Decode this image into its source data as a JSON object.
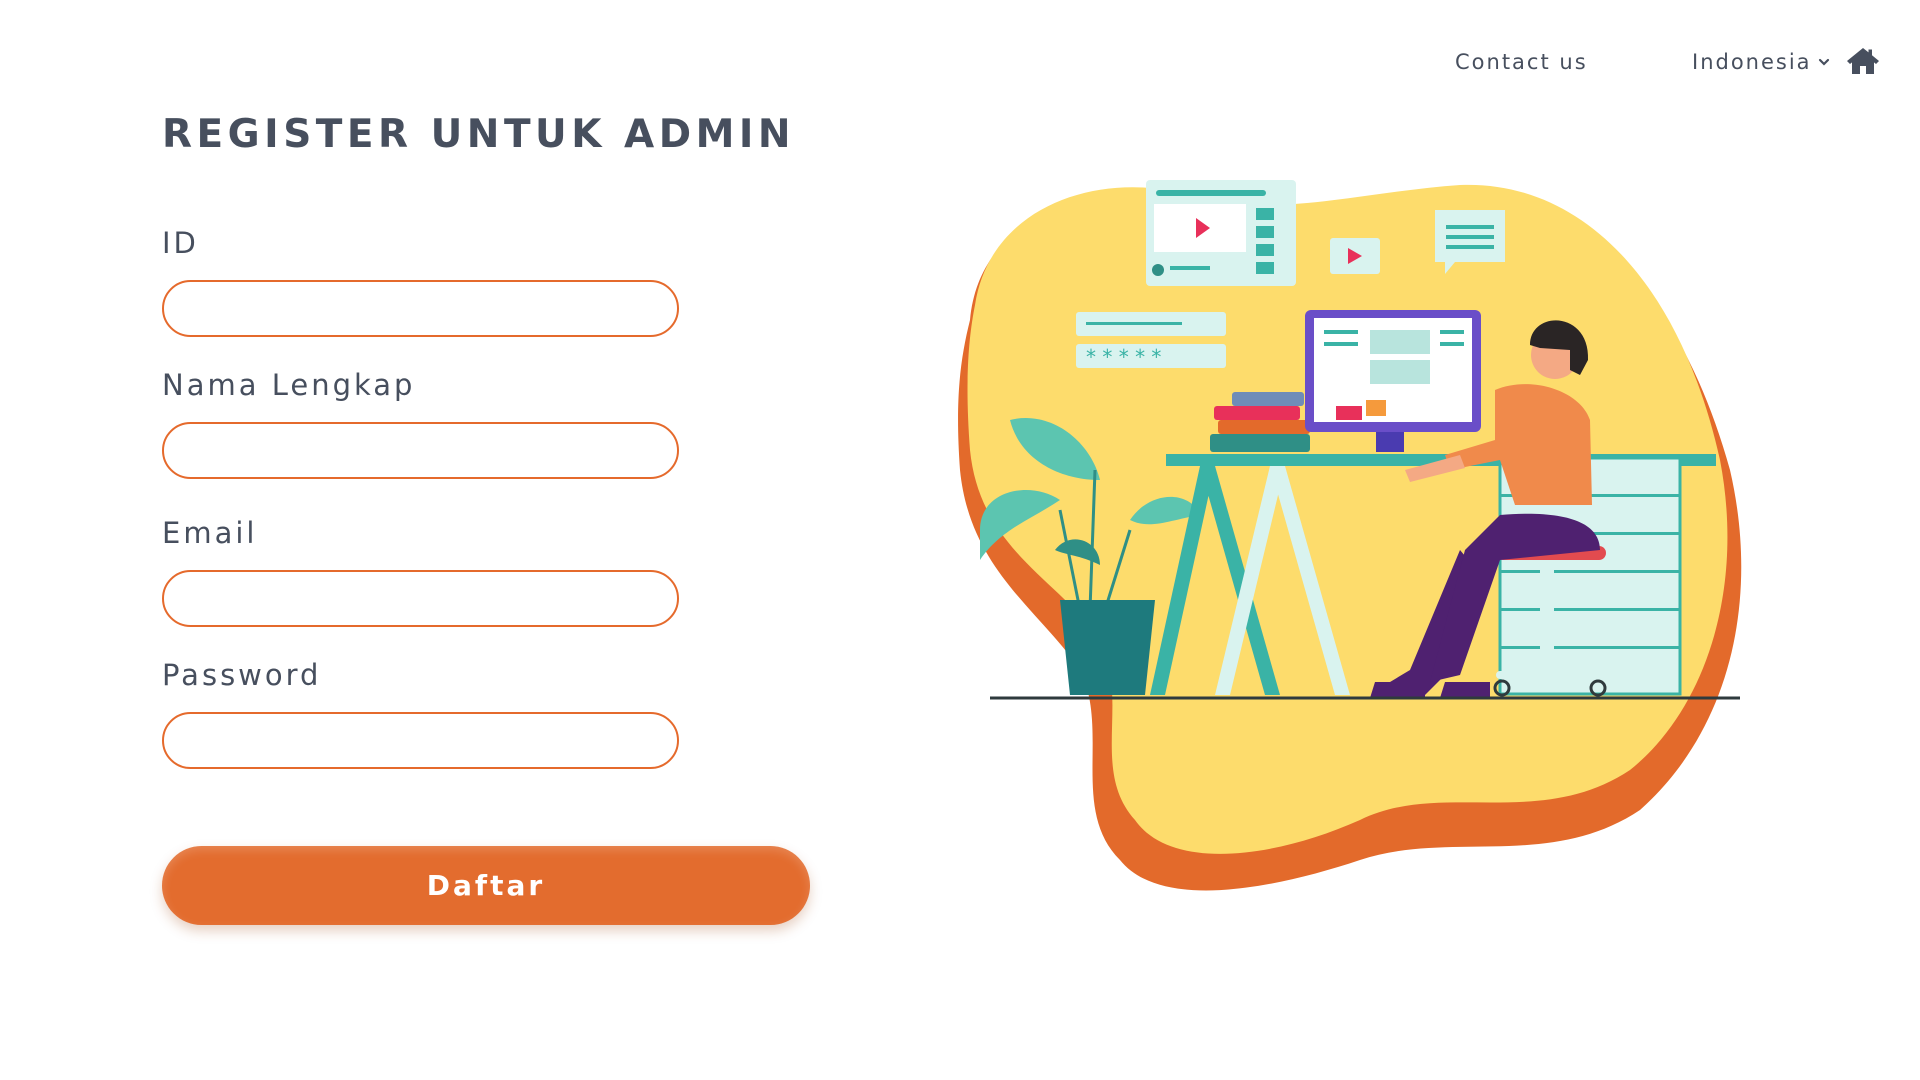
{
  "nav": {
    "contact": "Contact us",
    "language": "Indonesia"
  },
  "form": {
    "title": "REGISTER UNTUK ADMIN",
    "fields": [
      {
        "label": "ID",
        "value": ""
      },
      {
        "label": "Nama Lengkap",
        "value": ""
      },
      {
        "label": "Email",
        "value": ""
      },
      {
        "label": "Password",
        "value": ""
      }
    ],
    "submit_label": "Daftar"
  },
  "icons": {
    "home": "home-icon",
    "language_dropdown": "chevron-down-icon"
  },
  "colors": {
    "accent": "#e36c2e",
    "text": "#474f5e",
    "blob_yellow": "#fddc6c",
    "blob_orange": "#e36a2b",
    "teal": "#3ab3a6"
  }
}
